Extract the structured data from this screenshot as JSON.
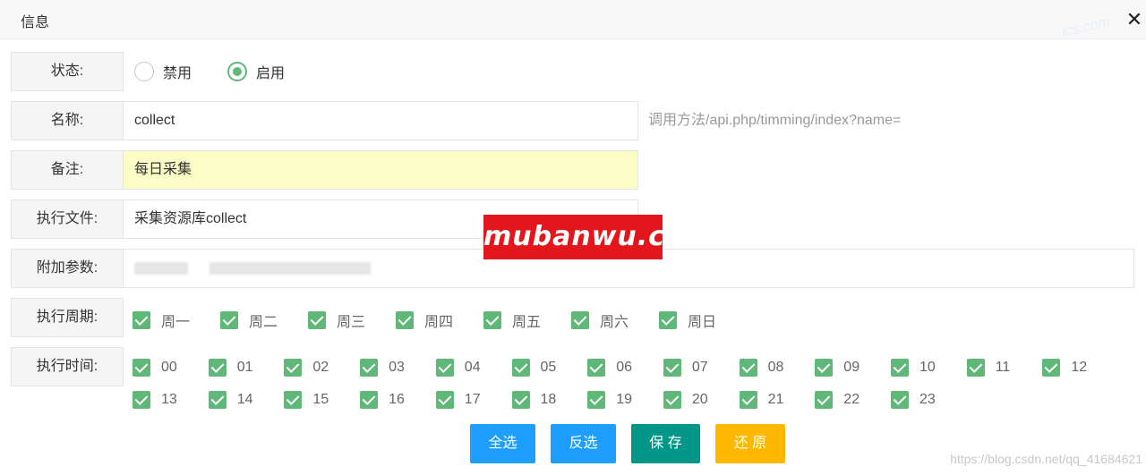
{
  "dialog": {
    "title": "信息",
    "close_glyph": "✕",
    "corner_watermark": "ics.com"
  },
  "form": {
    "status": {
      "label": "状态:",
      "options": [
        "禁用",
        "启用"
      ],
      "selected": "启用"
    },
    "name": {
      "label": "名称:",
      "value": "collect",
      "hint": "调用方法/api.php/timming/index?name="
    },
    "remark": {
      "label": "备注:",
      "value": "每日采集"
    },
    "file": {
      "label": "执行文件:",
      "value": "采集资源库collect"
    },
    "params": {
      "label": "附加参数:",
      "value": ""
    },
    "weekdays": {
      "label": "执行周期:",
      "items": [
        "周一",
        "周二",
        "周三",
        "周四",
        "周五",
        "周六",
        "周日"
      ],
      "checked": true
    },
    "hours": {
      "label": "执行时间:",
      "items": [
        "00",
        "01",
        "02",
        "03",
        "04",
        "05",
        "06",
        "07",
        "08",
        "09",
        "10",
        "11",
        "12",
        "13",
        "14",
        "15",
        "16",
        "17",
        "18",
        "19",
        "20",
        "21",
        "22",
        "23"
      ],
      "checked": true
    }
  },
  "buttons": {
    "select_all": "全选",
    "invert": "反选",
    "save": "保 存",
    "restore": "还 原"
  },
  "colors": {
    "check": "#5fb878",
    "btn_blue": "#1e9fff",
    "btn_teal": "#009688",
    "btn_orange": "#ffb800",
    "highlight": "#fafdc6"
  },
  "watermarks": {
    "logo": "mubanwu.cc",
    "csdn": "https://blog.csdn.net/qq_41684621"
  }
}
